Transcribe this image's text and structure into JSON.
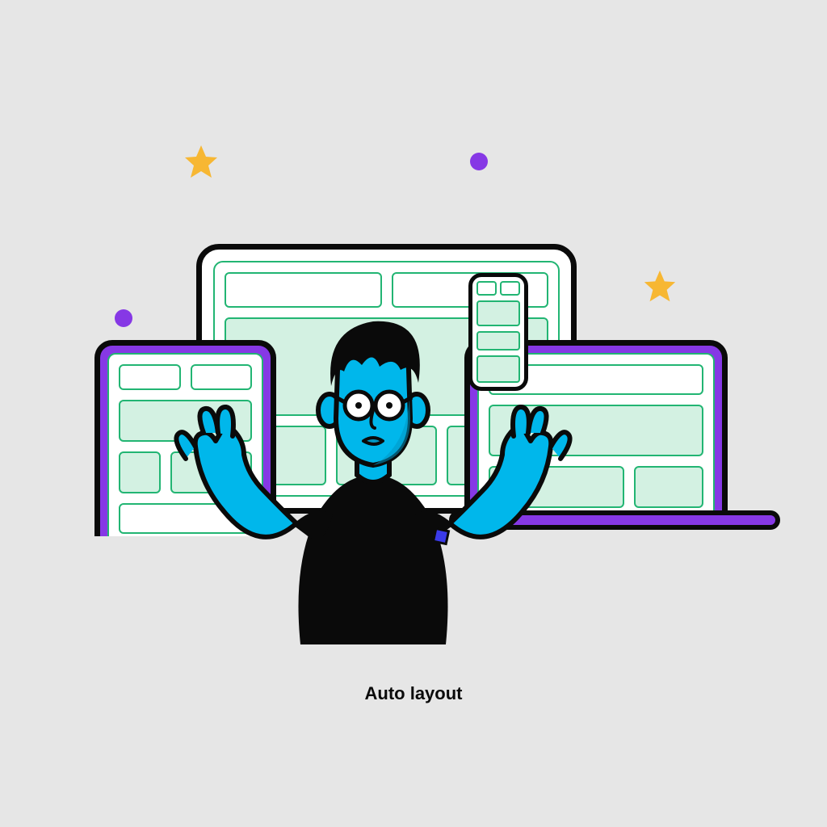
{
  "caption": "Auto layout",
  "colors": {
    "background": "#E6E6E6",
    "purple": "#8638E5",
    "green_line": "#22B573",
    "green_fill": "#D3F1E2",
    "black": "#0A0A0A",
    "yellow": "#F7B733",
    "skin": "#00B7EB",
    "skin_dark": "#0098C4"
  },
  "decorations": {
    "dot1": "purple-dot",
    "dot2": "purple-dot",
    "star1": "star-icon",
    "star2": "star-icon"
  }
}
